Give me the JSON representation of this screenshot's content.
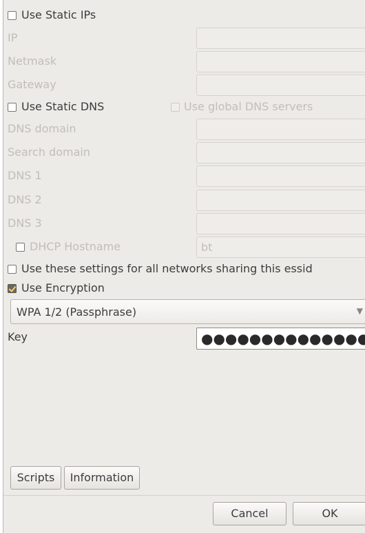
{
  "static_ips": {
    "label": "Use Static IPs",
    "checked": false
  },
  "ip": {
    "label": "IP",
    "value": ""
  },
  "netmask": {
    "label": "Netmask",
    "value": ""
  },
  "gateway": {
    "label": "Gateway",
    "value": ""
  },
  "static_dns": {
    "label": "Use Static DNS",
    "checked": false
  },
  "global_dns": {
    "label": "Use global DNS servers",
    "checked": false
  },
  "dns_domain": {
    "label": "DNS domain",
    "value": ""
  },
  "search_domain": {
    "label": "Search domain",
    "value": ""
  },
  "dns1": {
    "label": "DNS 1",
    "value": ""
  },
  "dns2": {
    "label": "DNS 2",
    "value": ""
  },
  "dns3": {
    "label": "DNS 3",
    "value": ""
  },
  "dhcp_hostname": {
    "label": "DHCP Hostname",
    "value": "bt",
    "checked": false
  },
  "all_networks": {
    "label": "Use these settings for all networks sharing this essid",
    "checked": false
  },
  "encryption": {
    "label": "Use Encryption",
    "checked": true
  },
  "encryption_type": {
    "selected": "WPA 1/2 (Passphrase)",
    "arrow_icon": "dropdown-arrow-icon"
  },
  "key": {
    "label": "Key",
    "masked_value": "●●●●●●●●●●●●●●●●"
  },
  "buttons": {
    "scripts": "Scripts",
    "information": "Information",
    "cancel": "Cancel",
    "ok": "OK"
  }
}
